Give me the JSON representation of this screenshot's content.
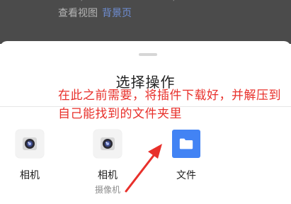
{
  "background": {
    "cut_text": "…… / …… ……………… /",
    "view_label": "查看视图",
    "link_label": "背景页"
  },
  "sheet": {
    "title": "选择操作",
    "options": [
      {
        "label": "相机",
        "sublabel": "",
        "icon": "camera-icon"
      },
      {
        "label": "相机",
        "sublabel": "摄像机",
        "icon": "camera-icon"
      },
      {
        "label": "文件",
        "sublabel": "",
        "icon": "folder-icon"
      }
    ]
  },
  "annotation": {
    "text": "在此之前需要，将插件下载好，并解压到自己能找到的文件夹里",
    "color": "#e8302b"
  },
  "colors": {
    "files_icon_bg": "#4283f4",
    "link": "#6f8fd6",
    "dim_overlay": "#4b4b4b"
  }
}
